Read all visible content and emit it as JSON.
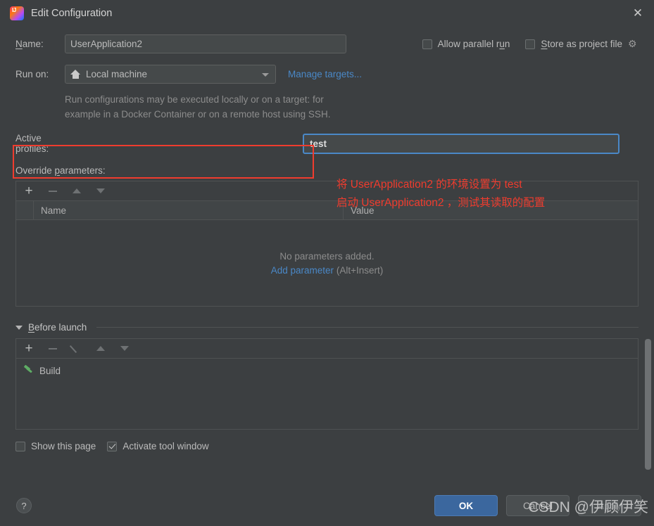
{
  "window": {
    "title": "Edit Configuration",
    "logo_icon": "intellij-idea-logo",
    "close_icon": "✕"
  },
  "name_row": {
    "label": "Name:",
    "value": "UserApplication2"
  },
  "top_checkboxes": {
    "allow_parallel_run": {
      "label": "Allow parallel run",
      "checked": false
    },
    "store_as_project_file": {
      "label": "Store as project file",
      "checked": false
    },
    "gear_icon": "⚙"
  },
  "run_on": {
    "label": "Run on:",
    "selected": "Local machine",
    "icon": "home-icon",
    "manage_targets_link": "Manage targets...",
    "hint_line1": "Run configurations may be executed locally or on a target: for",
    "hint_line2": "example in a Docker Container or on a remote host using SSH."
  },
  "active_profiles": {
    "label": "Active profiles:",
    "value": "test"
  },
  "override_parameters": {
    "label": "Override parameters:",
    "toolbar": {
      "add": "+",
      "remove": "−",
      "move_up": "up",
      "move_down": "down"
    },
    "columns": [
      "Name",
      "Value"
    ],
    "rows": [],
    "empty_text": "No parameters added.",
    "add_link": "Add parameter",
    "add_shortcut": "(Alt+Insert)"
  },
  "before_launch": {
    "title": "Before launch",
    "toolbar": {
      "add": "+",
      "remove": "−",
      "edit": "pencil",
      "move_up": "up",
      "move_down": "down"
    },
    "items": [
      {
        "label": "Build",
        "icon": "hammer-icon"
      }
    ]
  },
  "bottom_checkboxes": {
    "show_this_page": {
      "label": "Show this page",
      "checked": false
    },
    "activate_tool_window": {
      "label": "Activate tool window",
      "checked": true
    }
  },
  "footer": {
    "help_label": "?",
    "ok": "OK",
    "cancel": "Cancel",
    "apply": "Apply"
  },
  "annotation": {
    "line1": "将 UserApplication2 的环境设置为 test",
    "line2": "启动 UserApplication2 ，测试其读取的配置",
    "box_color": "#f03c2e"
  },
  "watermark": "CSDN @伊顾伊笑",
  "colors": {
    "background": "#3c3f41",
    "field_background": "#45494a",
    "accent_blue": "#4a88c7",
    "primary_button": "#3b679e",
    "annotation_red": "#f03c2e",
    "hammer_green": "#5fad65"
  }
}
